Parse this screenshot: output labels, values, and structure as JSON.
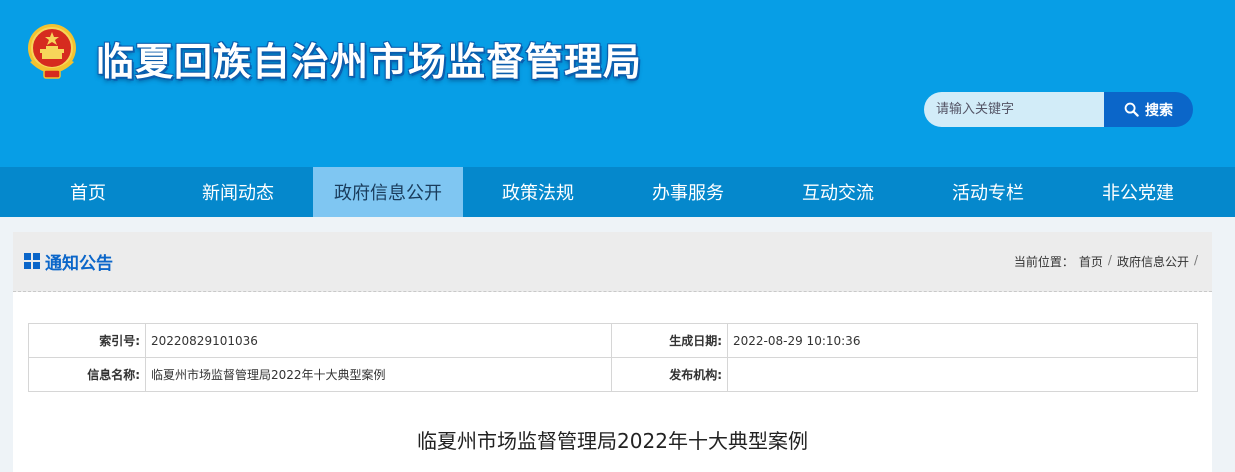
{
  "site": {
    "title": "临夏回族自治州市场监督管理局"
  },
  "search": {
    "placeholder": "请输入关键字",
    "button_label": "搜索"
  },
  "nav": {
    "items": [
      {
        "label": "首页"
      },
      {
        "label": "新闻动态"
      },
      {
        "label": "政府信息公开"
      },
      {
        "label": "政策法规"
      },
      {
        "label": "办事服务"
      },
      {
        "label": "互动交流"
      },
      {
        "label": "活动专栏"
      },
      {
        "label": "非公党建"
      }
    ],
    "active_index": 2
  },
  "panel": {
    "title": "通知公告",
    "breadcrumb": {
      "prefix": "当前位置：",
      "items": [
        "首页",
        "政府信息公开"
      ],
      "separator": "/"
    }
  },
  "info": {
    "index_label": "索引号:",
    "index_value": "20220829101036",
    "date_label": "生成日期:",
    "date_value": "2022-08-29 10:10:36",
    "name_label": "信息名称:",
    "name_value": "临夏州市场监督管理局2022年十大典型案例",
    "publisher_label": "发布机构:",
    "publisher_value": ""
  },
  "article": {
    "title": "临夏州市场监督管理局2022年十大典型案例"
  },
  "colors": {
    "header_bg": "#079ee6",
    "nav_bg": "#0588cc",
    "nav_active_bg": "#7fc6f2",
    "accent": "#0b66c9"
  }
}
